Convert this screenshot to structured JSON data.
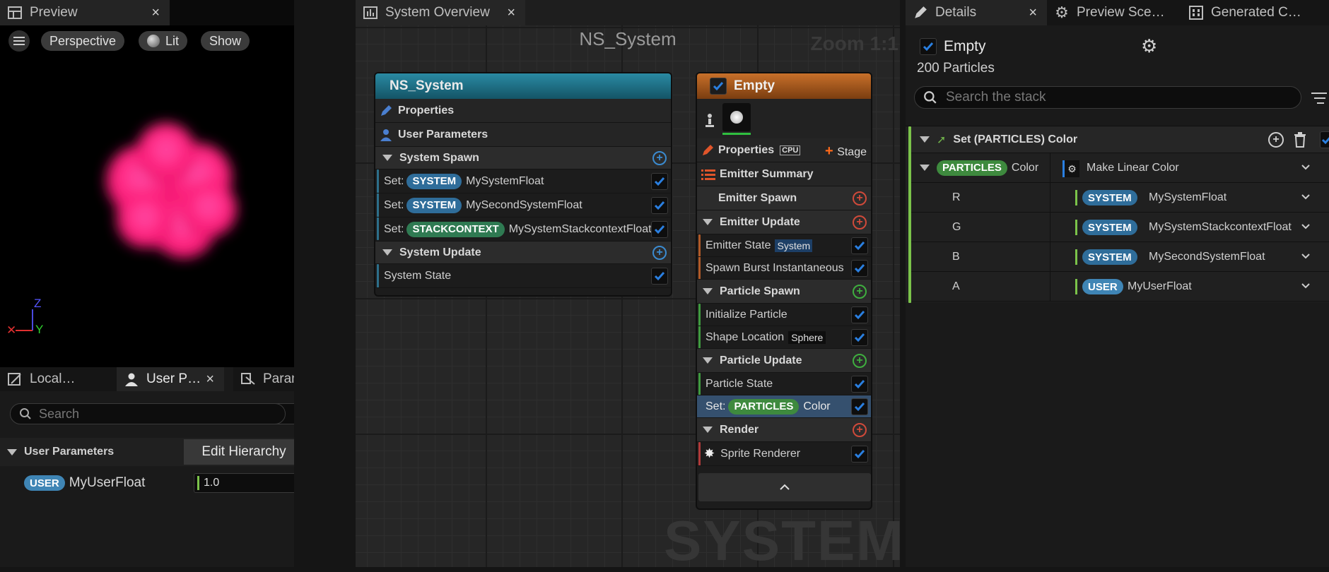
{
  "left_top_tab": {
    "title": "Preview",
    "close": "×"
  },
  "viewport": {
    "buttons": {
      "perspective": "Perspective",
      "lit": "Lit",
      "show": "Show"
    },
    "axis": {
      "z": "Z",
      "x": "✕",
      "y": "Y"
    }
  },
  "left_bottom_tabs": [
    {
      "label": "Local…"
    },
    {
      "label": "User P…",
      "close": "×"
    },
    {
      "label": "Param…"
    }
  ],
  "user_params_panel": {
    "search_placeholder": "Search",
    "section": "User Parameters",
    "edit_hierarchy": "Edit Hierarchy",
    "add": "+",
    "param": {
      "badge": "USER",
      "name": "MyUserFloat",
      "value": "1.0"
    }
  },
  "center_tab": {
    "title": "System Overview",
    "close": "×"
  },
  "graph": {
    "title": "NS_System",
    "zoom": "Zoom 1:1",
    "watermark": "SYSTEM"
  },
  "system_node": {
    "title": "NS_System",
    "properties": "Properties",
    "user_parameters": "User Parameters",
    "system_spawn": "System Spawn",
    "spawn_rows": [
      {
        "prefix": "Set:",
        "badge": "SYSTEM",
        "name": "MySystemFloat"
      },
      {
        "prefix": "Set:",
        "badge": "SYSTEM",
        "name": "MySecondSystemFloat"
      },
      {
        "prefix": "Set:",
        "badge": "STACKCONTEXT",
        "name": "MySystemStackcontextFloat"
      }
    ],
    "system_update": "System Update",
    "system_state": "System State"
  },
  "emitter_node": {
    "title": "Empty",
    "properties": "Properties",
    "cpu": "CPU",
    "stage": "Stage",
    "emitter_summary": "Emitter Summary",
    "emitter_spawn": "Emitter Spawn",
    "emitter_update": "Emitter Update",
    "emitter_state": "Emitter State",
    "emitter_state_tag": "System",
    "spawn_burst": "Spawn Burst Instantaneous",
    "particle_spawn": "Particle Spawn",
    "initialize_particle": "Initialize Particle",
    "shape_location": "Shape Location",
    "shape_tag": "Sphere",
    "particle_update": "Particle Update",
    "particle_state": "Particle State",
    "set_color": {
      "prefix": "Set:",
      "badge": "PARTICLES",
      "name": "Color"
    },
    "render": "Render",
    "sprite_renderer": "Sprite Renderer"
  },
  "right_tabs": [
    {
      "label": "Details",
      "close": "×"
    },
    {
      "label": "Preview Sce…"
    },
    {
      "label": "Generated C…"
    }
  ],
  "details": {
    "emitter_name": "Empty",
    "particles": "200 Particles",
    "search_placeholder": "Search the stack",
    "module_title": "Set (PARTICLES) Color",
    "color_row": {
      "badge": "PARTICLES",
      "name": "Color",
      "value": "Make Linear Color"
    },
    "channels": [
      {
        "label": "R",
        "badge": "SYSTEM",
        "value": "MySystemFloat"
      },
      {
        "label": "G",
        "badge": "SYSTEM",
        "value": "MySystemStackcontextFloat"
      },
      {
        "label": "B",
        "badge": "SYSTEM",
        "value": "MySecondSystemFloat"
      },
      {
        "label": "A",
        "badge": "USER",
        "value": "MyUserFloat"
      }
    ]
  },
  "colors": {
    "accent_blue": "#1a73e8",
    "particle_pink": "#ff2a8a",
    "system_header": "#1f6f86",
    "emitter_header": "#b8621a",
    "module_green": "#7bc34a"
  }
}
